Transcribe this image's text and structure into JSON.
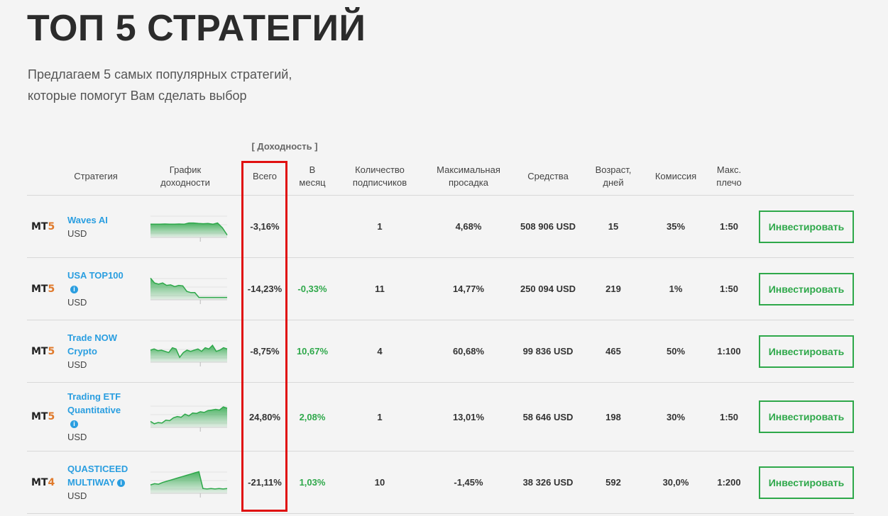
{
  "page": {
    "title": "ТОП 5 СТРАТЕГИЙ",
    "subtitle_line1": "Предлагаем 5 самых популярных стратегий,",
    "subtitle_line2": "которые помогут Вам сделать выбор"
  },
  "table": {
    "yield_group_label": "[ Доходность ]",
    "headers": {
      "strategy": "Стратегия",
      "chart_line1": "График",
      "chart_line2": "доходности",
      "total": "Всего",
      "month_line1": "В",
      "month_line2": "месяц",
      "subs_line1": "Количество",
      "subs_line2": "подписчиков",
      "dd_line1": "Максимальная",
      "dd_line2": "просадка",
      "funds": "Средства",
      "age_line1": "Возраст,",
      "age_line2": "дней",
      "commission": "Комиссия",
      "leverage_line1": "Макс.",
      "leverage_line2": "плечо"
    },
    "invest_label": "Инвестировать",
    "rows": [
      {
        "platform_prefix": "MT",
        "platform_version": "5",
        "name_line1": "Waves AI",
        "name_line2": "",
        "has_info": false,
        "currency": "USD",
        "total": "-3,16%",
        "month": "",
        "subscribers": "1",
        "drawdown": "4,68%",
        "funds": "508 906 USD",
        "age": "15",
        "commission": "35%",
        "leverage": "1:50",
        "spark": [
          0.55,
          0.55,
          0.55,
          0.56,
          0.55,
          0.55,
          0.56,
          0.55,
          0.6,
          0.6,
          0.58,
          0.57,
          0.58,
          0.55,
          0.6,
          0.4,
          0.1
        ]
      },
      {
        "platform_prefix": "MT",
        "platform_version": "5",
        "name_line1": "USA TOP100",
        "name_line2": "",
        "has_info": true,
        "currency": "USD",
        "total": "-14,23%",
        "month": "-0,33%",
        "subscribers": "11",
        "drawdown": "14,77%",
        "funds": "250 094 USD",
        "age": "219",
        "commission": "1%",
        "leverage": "1:50",
        "spark": [
          0.9,
          0.7,
          0.65,
          0.7,
          0.6,
          0.62,
          0.55,
          0.6,
          0.58,
          0.35,
          0.3,
          0.3,
          0.1,
          0.1,
          0.1,
          0.1,
          0.1,
          0.1,
          0.1,
          0.1
        ]
      },
      {
        "platform_prefix": "MT",
        "platform_version": "5",
        "name_line1": "Trade NOW",
        "name_line2": "Crypto",
        "has_info": false,
        "currency": "USD",
        "total": "-8,75%",
        "month": "10,67%",
        "subscribers": "4",
        "drawdown": "60,68%",
        "funds": "99 836 USD",
        "age": "465",
        "commission": "50%",
        "leverage": "1:100",
        "spark": [
          0.5,
          0.55,
          0.48,
          0.5,
          0.45,
          0.4,
          0.6,
          0.55,
          0.2,
          0.4,
          0.5,
          0.45,
          0.5,
          0.55,
          0.45,
          0.6,
          0.55,
          0.7,
          0.45,
          0.5,
          0.6,
          0.55
        ]
      },
      {
        "platform_prefix": "MT",
        "platform_version": "5",
        "name_line1": "Trading ETF",
        "name_line2": "Quantitative",
        "has_info": true,
        "currency": "USD",
        "total": "24,80%",
        "month": "2,08%",
        "subscribers": "1",
        "drawdown": "13,01%",
        "funds": "58 646 USD",
        "age": "198",
        "commission": "30%",
        "leverage": "1:50",
        "spark": [
          0.25,
          0.15,
          0.2,
          0.18,
          0.3,
          0.28,
          0.4,
          0.45,
          0.42,
          0.55,
          0.48,
          0.6,
          0.58,
          0.65,
          0.62,
          0.7,
          0.72,
          0.75,
          0.72,
          0.85,
          0.8
        ]
      },
      {
        "platform_prefix": "MT",
        "platform_version": "4",
        "name_line1": "QUASTICEED",
        "name_line2": "MULTIWAY",
        "has_info": true,
        "currency": "USD",
        "total": "-21,11%",
        "month": "1,03%",
        "subscribers": "10",
        "drawdown": "-1,45%",
        "funds": "38 326 USD",
        "age": "592",
        "commission": "30,0%",
        "leverage": "1:200",
        "spark": [
          0.35,
          0.4,
          0.38,
          0.45,
          0.5,
          0.55,
          0.6,
          0.65,
          0.7,
          0.75,
          0.8,
          0.85,
          0.9,
          0.2,
          0.18,
          0.2,
          0.18,
          0.2,
          0.18,
          0.2
        ]
      }
    ]
  },
  "colors": {
    "link": "#2a9ee0",
    "positive": "#2ea84a",
    "chart_line": "#2ea84a",
    "highlight_border": "#e01010",
    "platform_version": "#e07a2c"
  }
}
